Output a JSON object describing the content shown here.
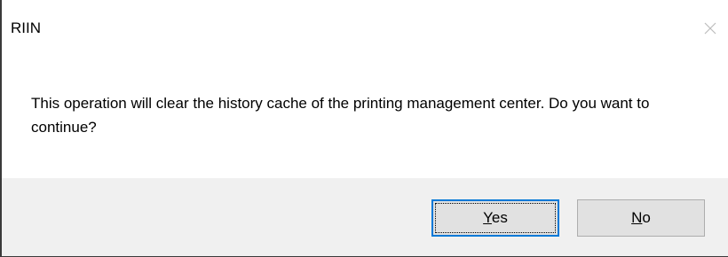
{
  "window": {
    "title": "RIIN"
  },
  "dialog": {
    "message": "This operation will clear the history cache of the printing management center. Do you want to continue?"
  },
  "buttons": {
    "yes": {
      "mnemonic": "Y",
      "rest": "es"
    },
    "no": {
      "mnemonic": "N",
      "rest": "o"
    }
  },
  "icons": {
    "close": "close-icon"
  },
  "colors": {
    "footer_bg": "#f0f0f0",
    "button_bg": "#e1e1e1",
    "default_button_border": "#0078d7"
  }
}
